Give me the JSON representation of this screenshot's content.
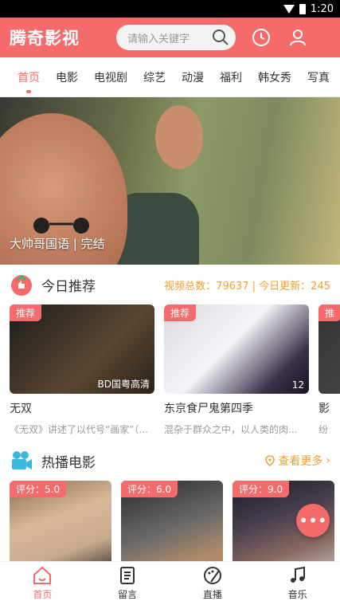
{
  "status": {
    "time": "1:20"
  },
  "header": {
    "title": "腾奇影视",
    "search_placeholder": "请输入关键字"
  },
  "tabs": [
    {
      "label": "首页",
      "active": true
    },
    {
      "label": "电影"
    },
    {
      "label": "电视剧"
    },
    {
      "label": "综艺"
    },
    {
      "label": "动漫"
    },
    {
      "label": "福利"
    },
    {
      "label": "韩女秀"
    },
    {
      "label": "写真"
    }
  ],
  "banner": {
    "caption": "大帅哥国语 | 完结"
  },
  "today": {
    "title": "今日推荐",
    "stats": "视频总数：79637 | 今日更新：245",
    "cards": [
      {
        "tag": "推荐",
        "corner": "BD国粤高清",
        "name": "无双",
        "desc": "《无双》讲述了以代号“画家”（..."
      },
      {
        "tag": "推荐",
        "corner": "12",
        "name": "东京食尸鬼第四季",
        "desc": "混杂于群众之中，以人类的肉..."
      },
      {
        "tag": "推",
        "corner": "",
        "name": "影",
        "desc": "纷"
      }
    ]
  },
  "hot": {
    "title": "热播电影",
    "more": "查看更多",
    "cards": [
      {
        "score": "评分：5.0"
      },
      {
        "score": "评分：6.0"
      },
      {
        "score": "评分：9.0"
      }
    ]
  },
  "fab": {
    "label": "•••"
  },
  "bottom_nav": [
    {
      "label": "首页",
      "icon": "home-icon",
      "active": true
    },
    {
      "label": "留言",
      "icon": "message-icon"
    },
    {
      "label": "直播",
      "icon": "palette-icon"
    },
    {
      "label": "音乐",
      "icon": "music-icon"
    }
  ],
  "colors": {
    "accent": "#f56a6a",
    "stats": "#f0a030"
  }
}
